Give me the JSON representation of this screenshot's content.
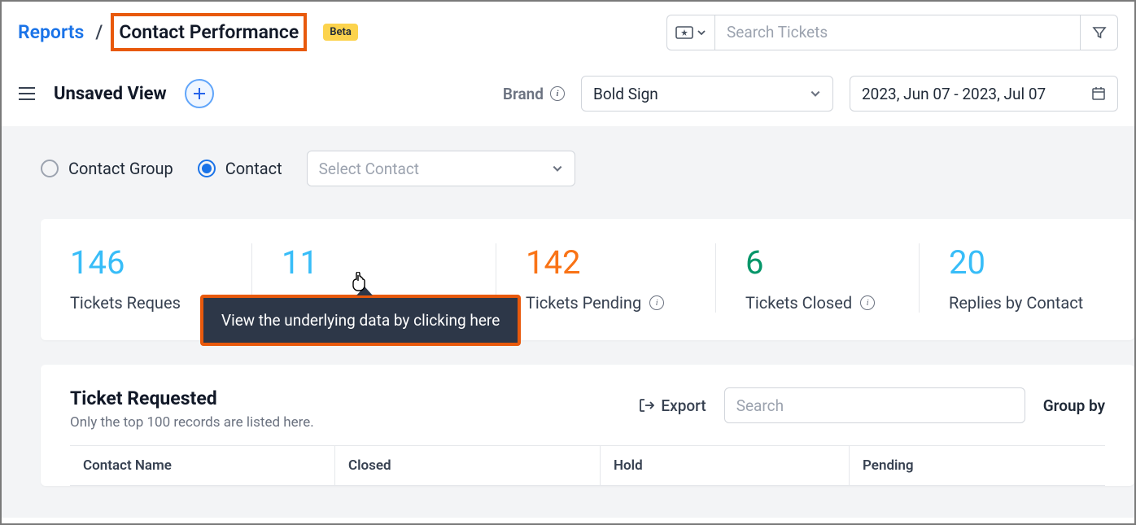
{
  "breadcrumb": {
    "root": "Reports",
    "current": "Contact Performance",
    "badge": "Beta"
  },
  "search": {
    "placeholder": "Search Tickets"
  },
  "view": {
    "title": "Unsaved View"
  },
  "brand": {
    "label": "Brand",
    "selected": "Bold Sign"
  },
  "daterange": {
    "value": "2023, Jun 07 - 2023, Jul 07"
  },
  "filters": {
    "group_label": "Contact Group",
    "contact_label": "Contact",
    "contact_placeholder": "Select Contact"
  },
  "stats": [
    {
      "value": "146",
      "label": "Tickets Reques",
      "color": "c-blue",
      "info": false
    },
    {
      "value": "11",
      "label": "",
      "color": "c-blue",
      "info": false
    },
    {
      "value": "142",
      "label": "Tickets Pending",
      "color": "c-orange",
      "info": true
    },
    {
      "value": "6",
      "label": "Tickets Closed",
      "color": "c-green",
      "info": true
    },
    {
      "value": "20",
      "label": "Replies by Contact",
      "color": "c-blue",
      "info": false
    }
  ],
  "tooltip": {
    "text": "View the underlying data by clicking here"
  },
  "table": {
    "title": "Ticket Requested",
    "subtitle": "Only the top 100 records are listed here.",
    "export": "Export",
    "search_placeholder": "Search",
    "groupby": "Group by",
    "columns": [
      "Contact Name",
      "Closed",
      "Hold",
      "Pending"
    ]
  }
}
